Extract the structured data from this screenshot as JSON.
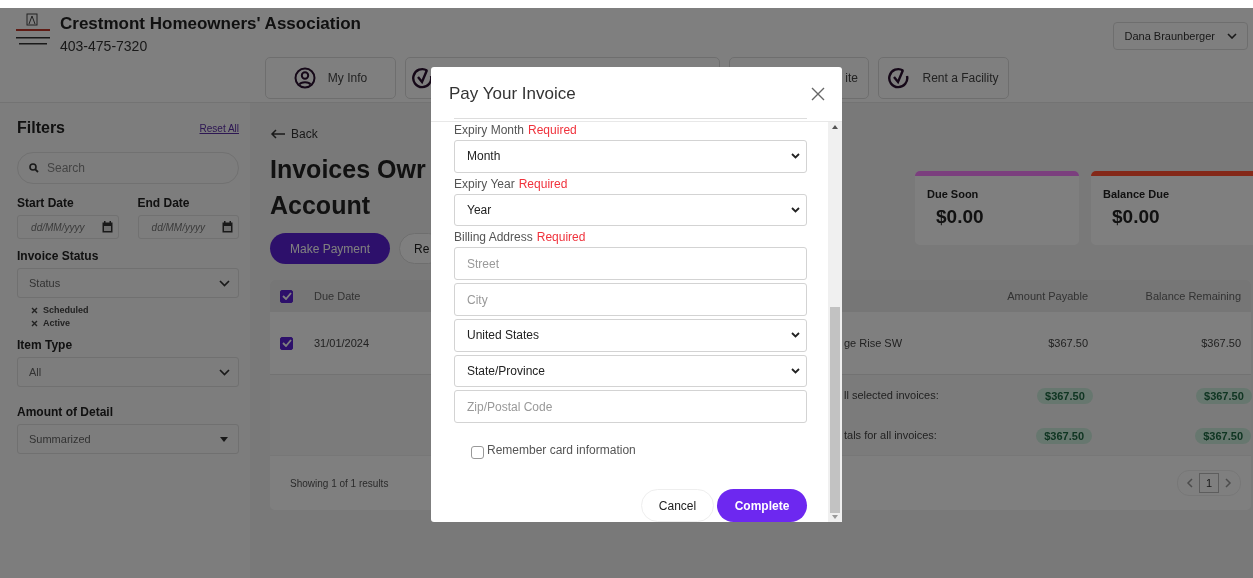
{
  "header": {
    "org_name": "Crestmont Homeowners' Association",
    "phone": "403-475-7320",
    "user_menu": "Dana Braunberger",
    "nav": [
      {
        "kind": "person",
        "label": "My Info"
      },
      {
        "kind": "check"
      },
      {
        "kind": "plain",
        "label": "ite"
      },
      {
        "kind": "check",
        "label": "Rent a Facility"
      }
    ]
  },
  "sidebar": {
    "title": "Filters",
    "reset": "Reset All",
    "search": {
      "placeholder": "Search"
    },
    "dates": [
      {
        "label": "Start Date",
        "placeholder": "dd/MM/yyyy"
      },
      {
        "label": "End Date",
        "placeholder": "dd/MM/yyyy"
      }
    ],
    "invoice_status": {
      "label": "Invoice Status",
      "value": "Status",
      "chips": [
        "Scheduled",
        "Active"
      ]
    },
    "item_type": {
      "label": "Item Type",
      "value": "All"
    },
    "detail": {
      "label": "Amount of Detail",
      "value": "Summarized"
    }
  },
  "main": {
    "back": "Back",
    "title_lines": [
      "Invoices Owr",
      "Account"
    ],
    "buttons": [
      {
        "kind": "primary",
        "label": "Make Payment"
      },
      {
        "kind": "secondary",
        "label": "Re"
      }
    ],
    "cards": [
      {
        "title": "Due Soon",
        "amount": "$0.00",
        "color": "#7b3f7e"
      },
      {
        "title": "Balance Due",
        "amount": "$0.00",
        "color": "#842818"
      }
    ],
    "table": {
      "all_checked": true,
      "columns": [
        "Due Date",
        "Amount Payable",
        "Balance Remaining"
      ],
      "rows": [
        {
          "checked": true,
          "due_date": "31/01/2024",
          "column_3": "ge Rise SW",
          "amount": "$367.50",
          "balance": "$367.50"
        }
      ],
      "totals": [
        {
          "label": "ll selected invoices:",
          "amount": "$367.50",
          "balance": "$367.50"
        },
        {
          "label": "tals for all invoices:",
          "amount": "$367.50",
          "balance": "$367.50"
        }
      ],
      "footer": "Showing 1 of 1 results",
      "page": "1"
    }
  },
  "modal": {
    "title": "Pay Your Invoice",
    "fields": [
      {
        "kind": "select",
        "label": "Expiry Month",
        "required": "Required",
        "value": "Month"
      },
      {
        "kind": "select",
        "label": "Expiry Year",
        "required": "Required",
        "value": "Year"
      },
      {
        "kind": "heading",
        "label": "Billing Address",
        "required": "Required"
      },
      {
        "kind": "input",
        "placeholder": "Street"
      },
      {
        "kind": "input",
        "placeholder": "City"
      },
      {
        "kind": "select",
        "value": "United States"
      },
      {
        "kind": "select",
        "value": "State/Province"
      },
      {
        "kind": "input",
        "placeholder": "Zip/Postal Code"
      }
    ],
    "remember": {
      "label": "Remember card information",
      "checked": false
    },
    "buttons": [
      {
        "kind": "secondary",
        "label": "Cancel"
      },
      {
        "kind": "primary",
        "label": "Complete"
      }
    ]
  }
}
